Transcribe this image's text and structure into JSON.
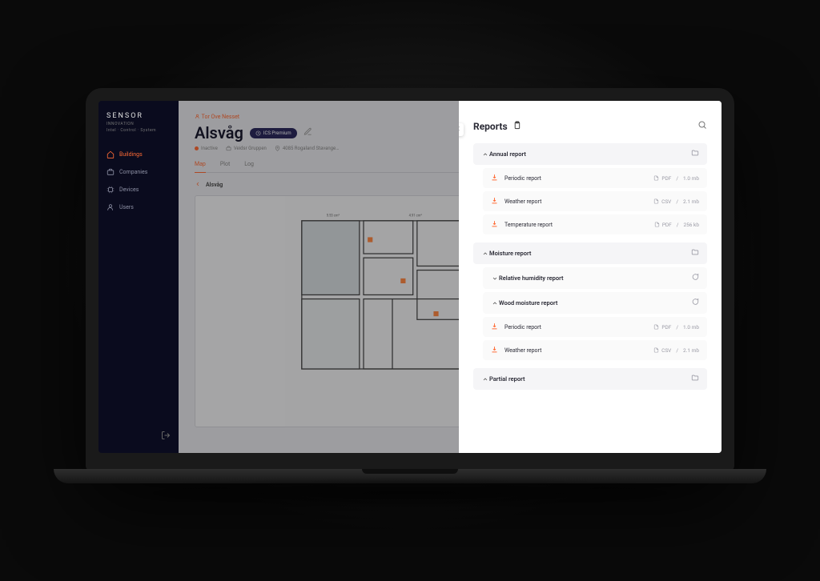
{
  "logo": {
    "name": "SENSOR",
    "subtitle": "INNOVATION",
    "tagline": "Intel · Control · System"
  },
  "sidebar": {
    "items": [
      {
        "label": "Buildings",
        "icon": "home",
        "active": true
      },
      {
        "label": "Companies",
        "icon": "briefcase",
        "active": false
      },
      {
        "label": "Devices",
        "icon": "cpu",
        "active": false
      },
      {
        "label": "Users",
        "icon": "user",
        "active": false
      }
    ]
  },
  "page": {
    "owner": "Tor Ove Nesset",
    "title": "Alsvåg",
    "badge": "ICS Premium",
    "status": "Inactive",
    "company": "Veidsr Gruppen",
    "address": "4085 Rogaland Stavange…"
  },
  "tabs": [
    {
      "label": "Map",
      "active": true
    },
    {
      "label": "Plot",
      "active": false
    },
    {
      "label": "Log",
      "active": false
    }
  ],
  "breadcrumb": "Alsvåg",
  "panel": {
    "title": "Reports",
    "groups": [
      {
        "label": "Annual report",
        "open": true,
        "icon": "folder",
        "files": [
          {
            "label": "Periodic report",
            "type": "PDF",
            "size": "1.0 mb"
          },
          {
            "label": "Weather report",
            "type": "CSV",
            "size": "2.1 mb"
          },
          {
            "label": "Temperature report",
            "type": "PDF",
            "size": "256 kb"
          }
        ]
      },
      {
        "label": "Moisture report",
        "open": true,
        "icon": "folder",
        "subgroups": [
          {
            "label": "Relative humidity report",
            "open": false,
            "icon": "chat"
          },
          {
            "label": "Wood moisture report",
            "open": true,
            "icon": "chat",
            "files": [
              {
                "label": "Periodic report",
                "type": "PDF",
                "size": "1.0 mb"
              },
              {
                "label": "Weather report",
                "type": "CSV",
                "size": "2.1 mb"
              }
            ]
          }
        ]
      },
      {
        "label": "Partial report",
        "open": false,
        "icon": "folder"
      }
    ]
  }
}
